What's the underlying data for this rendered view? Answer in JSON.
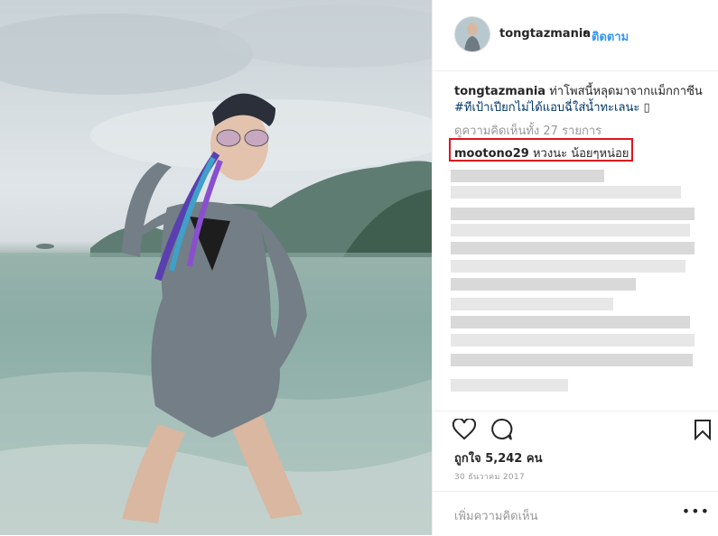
{
  "post": {
    "username": "tongtazmania",
    "dot": "•",
    "follow_label": "ติดตาม",
    "caption_text": "ท่าโพสนี้หลุดมาจากแม็กกาซีน",
    "caption_hashtag": "#ทีเป้าเปียกไม่ได้แอบฉี่ใส่น้ำทะเลนะ",
    "caption_emoji": "▯",
    "view_all_comments": "ดูความคิดเห็นทั้ง 27 รายการ",
    "highlighted_comment": {
      "username": "mootono29",
      "text": "หวงนะ น้อยๆหน่อย"
    },
    "likes": "ถูกใจ 5,242 คน",
    "date": "30 ธันวาคม 2017",
    "add_comment_placeholder": "เพิ่มความคิดเห็น",
    "more_label": "•••"
  },
  "icons": {
    "like": "heart-icon",
    "comment": "comment-bubble-icon",
    "save": "bookmark-icon"
  },
  "colors": {
    "follow": "#3897f0",
    "highlight_border": "#e0141e",
    "muted_text": "#999999"
  }
}
